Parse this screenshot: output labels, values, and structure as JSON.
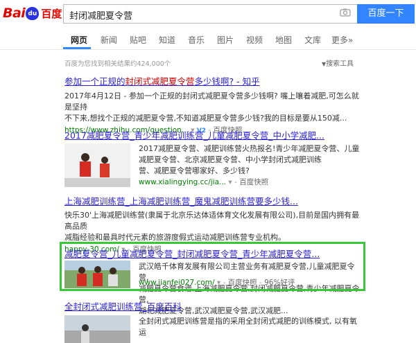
{
  "logo": {
    "part1": "Bai",
    "paw": "du",
    "part2": "百度"
  },
  "search": {
    "query": "封闭减肥夏令营",
    "button": "百度一下"
  },
  "nav": {
    "items": [
      "网页",
      "新闻",
      "贴吧",
      "知道",
      "音乐",
      "图片",
      "视频",
      "地图",
      "文库",
      "更多»"
    ]
  },
  "stats": {
    "count": "百度为您找到相关结果约424,000个",
    "tools": "搜索工具"
  },
  "results": [
    {
      "title_pre": "参加一个正规的",
      "title_em": "封闭式减肥夏令营",
      "title_post": "多少钱啊? - 知乎",
      "line1": "2017年4月12日 - 参加一个正规的封闭式减肥夏令营多少钱啊? 嘴上嚷着减肥,可怎么就是坚持",
      "line2": "不下来,想找个正规的减肥夏令营,不知道减肥夏令营多少钱?我的目标是要从150减...",
      "url": "https://www.zhihu.com/question...",
      "badge": "V2",
      "snap": "百度快照"
    },
    {
      "title": "2017减肥夏令营_青少年减肥训练营_儿童减肥夏令营_中小学减肥...",
      "line1": "2017减肥夏令营、减肥训练营火热报名!青少年减肥夏令营、儿童",
      "line2": "减肥夏令营、北京减肥夏令营、中小学封闭式减肥训练",
      "line3": "营、减肥夏令营哪家好、多少钱?",
      "url": "www.xialingying.cc/jia...",
      "snap": "百度快照"
    },
    {
      "title": "上海减肥训练营_上海减肥训练营_魔鬼减肥训练营要多少钱...",
      "line1": "快乐30'上海减肥训练营(隶属于北京乐达体适体育文化发展有限公司),目前是国内拥有最高品质",
      "line2": "减脂经验和最具时代元素的旅游度假式运动减肥训练营专业机构。",
      "url": "happy-30.com/",
      "snap": "百度快照"
    },
    {
      "title": "减肥夏令营_儿童减肥夏令营_封闭减肥夏令营_青少年减肥夏令营...",
      "line1": "武汉皓千体育发展有限公司主营业务有减肥夏令营,儿童减肥夏令营,",
      "line2": "减肥夏令营食谱,上海减肥夏令营,封闭减肥夏令营,青少年减肥夏令营,",
      "line3": "湖北减肥夏令营,武汉减肥夏令营,武汉减肥...",
      "url": "www.jianfei027.com/",
      "snap": "百度快照",
      "rating": "96%好评"
    },
    {
      "title": "全封闭式减肥训练营_百度百科",
      "line1": "全封闭式减肥训练营是指的采用全封闭式减肥的训练模式, 以有氧运"
    }
  ]
}
